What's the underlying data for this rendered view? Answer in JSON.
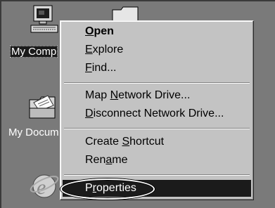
{
  "desktop": {
    "icons": [
      {
        "name": "my-computer",
        "label": "My Comp",
        "selected": true
      },
      {
        "name": "my-documents",
        "label": "My Docum",
        "selected": false
      }
    ]
  },
  "context_menu": {
    "items": [
      {
        "pre": "",
        "accel": "O",
        "post": "pen",
        "bold": true
      },
      {
        "pre": "",
        "accel": "E",
        "post": "xplore",
        "bold": false
      },
      {
        "pre": "",
        "accel": "F",
        "post": "ind...",
        "bold": false
      },
      {
        "pre": "Map ",
        "accel": "N",
        "post": "etwork Drive...",
        "bold": false
      },
      {
        "pre": "",
        "accel": "D",
        "post": "isconnect Network Drive...",
        "bold": false
      },
      {
        "pre": "Create ",
        "accel": "S",
        "post": "hortcut",
        "bold": false
      },
      {
        "pre": "Ren",
        "accel": "a",
        "post": "me",
        "bold": false
      },
      {
        "pre": "P",
        "accel": "r",
        "post": "operties",
        "bold": false,
        "highlighted": true
      }
    ]
  },
  "colors": {
    "desktop": "#7a7a7a",
    "menu_face": "#c3c3c3",
    "highlight": "#1b1b1b"
  }
}
